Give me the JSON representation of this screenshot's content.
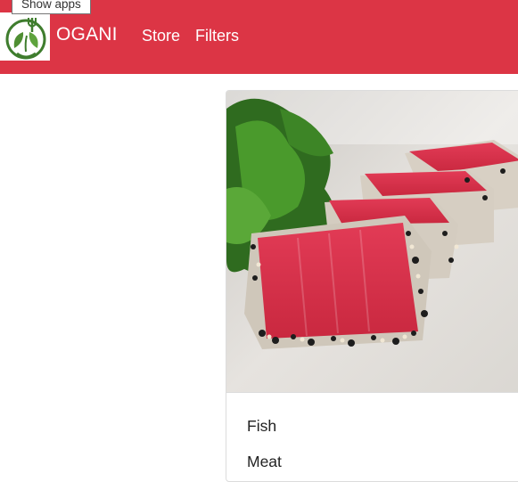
{
  "tooltip": {
    "text": "Show apps"
  },
  "navbar": {
    "brand": "OGANI",
    "links": [
      {
        "label": "Store"
      },
      {
        "label": "Filters"
      }
    ],
    "logo_icon": "leaf-fork-logo-icon",
    "background": "#dc3545"
  },
  "card": {
    "image_icon": "seared-tuna-photo",
    "categories": [
      {
        "label": "Fish"
      },
      {
        "label": "Meat"
      }
    ]
  }
}
